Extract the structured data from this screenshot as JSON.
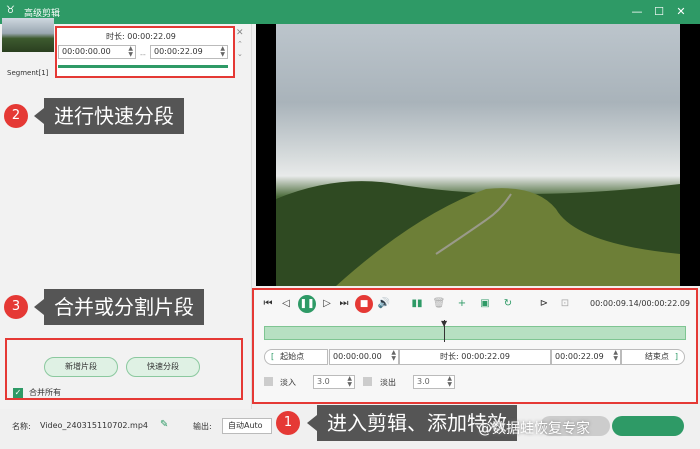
{
  "titlebar": {
    "title": "高级剪辑",
    "minimize": "—",
    "maximize": "☐",
    "close": "✕",
    "logo": "♉"
  },
  "segment": {
    "label": "Segment[1]",
    "duration_label": "时长: 00:00:22.09",
    "start_time": "00:00:00.00",
    "end_time": "00:00:22.09",
    "dash": "--"
  },
  "callouts": {
    "c2_num": "2",
    "c2_text": "进行快速分段",
    "c3_num": "3",
    "c3_text": "合并或分割片段",
    "c1_num": "1",
    "c1_text": "进入剪辑、添加特效"
  },
  "left_actions": {
    "new_segment": "新增片段",
    "quick_split": "快速分段",
    "merge_all": "合并所有",
    "check": "✓"
  },
  "player": {
    "time": "00:00:09.14/00:00:22.09"
  },
  "trim": {
    "start_btn": "起始点",
    "start_time": "00:00:00.00",
    "duration": "时长: 00:00:22.09",
    "end_time": "00:00:22.09",
    "end_btn": "结束点",
    "left_bracket": "[",
    "right_bracket": "]"
  },
  "fade": {
    "fade_in_label": "淡入",
    "fade_in_value": "3.0",
    "fade_out_label": "淡出",
    "fade_out_value": "3.0"
  },
  "bottom": {
    "name_label": "名称:",
    "name_value": "Video_240315110702.mp4",
    "output_label": "输出:",
    "output_value": "自动Auto"
  },
  "watermark": "@数据蛙恢复专家",
  "colors": {
    "accent": "#2e9a66",
    "highlight": "#e53935"
  }
}
